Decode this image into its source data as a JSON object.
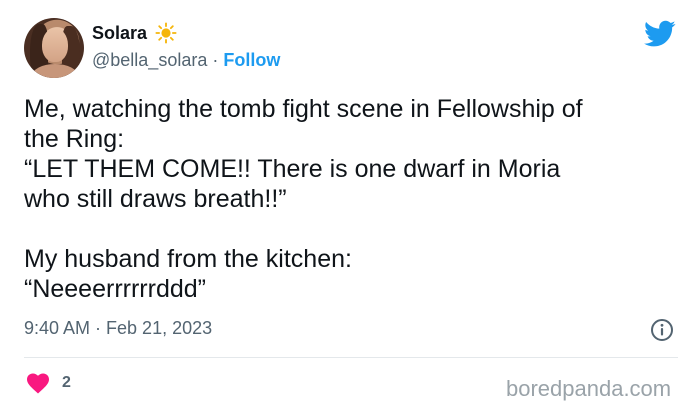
{
  "user": {
    "display_name": "Solara",
    "handle": "@bella_solara",
    "separator": "·",
    "follow_label": "Follow"
  },
  "tweet": {
    "text": "Me, watching the tomb fight scene in Fellowship of\nthe Ring:\n“LET THEM COME!! There is one dwarf in Moria\nwho still draws breath!!”\n\nMy husband from the kitchen:\n“Neeeerrrrrrddd”"
  },
  "meta": {
    "timestamp": "9:40 AM · Feb 21, 2023"
  },
  "engagement": {
    "like_count": "2"
  },
  "watermark": "boredpanda.com",
  "colors": {
    "accent": "#1d9bf0",
    "heart": "#f91880",
    "secondary_text": "#536471",
    "sun": "#f5b50a"
  },
  "icons": {
    "sun": "sun-icon",
    "bird": "twitter-bird-icon",
    "info": "info-icon",
    "heart": "heart-icon"
  }
}
